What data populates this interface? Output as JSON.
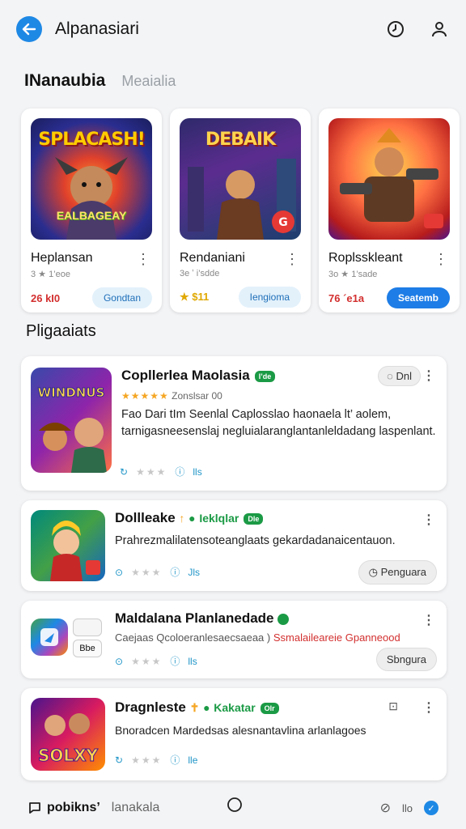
{
  "header": {
    "title": "Alpanasiari"
  },
  "tabs": {
    "active": "INanaubia",
    "inactive": "Meaialia"
  },
  "featured": [
    {
      "art_title": "SPLACASH!",
      "art_sub": "EALBAGEAY",
      "name": "Heplansan",
      "meta": "3 ★ 1’eoe",
      "price": "26 kI0",
      "button": "Gondtan"
    },
    {
      "art_title": "DEBAIK",
      "art_sub": "",
      "name": "Rendaniani",
      "meta": "3e ʼ i’sdde",
      "price": "★ $11",
      "button": "Iengioma"
    },
    {
      "art_title": "",
      "art_sub": "",
      "name": "Roplsskleant",
      "meta": "3o ★ 1’sade",
      "price": "76 ´e1a",
      "button": "Seatemb"
    }
  ],
  "section": {
    "title": "Pligaaiats"
  },
  "list": [
    {
      "name": "Copllerlea Maolasia",
      "badge": "I’de",
      "rating_text": "Zonslsar 00",
      "chip": "Dnl",
      "description": "Fao Dari tIm Seenlal Caplosslao haonaela lt’ aolem, tarnigasneesenslaj negluialaranglantanleldadang laspenlant.",
      "foot": "lls",
      "art_text": "WINDNUS"
    },
    {
      "name": "Dollleake",
      "badge": "Dle",
      "tag": "Ieklqlar",
      "description": "Prahrezmalilatensoteanglaats gekardadanaicentauon.",
      "foot": "Jls",
      "chip": "Penguara",
      "art_text": ""
    },
    {
      "name": "Maldalana Planlanedade",
      "badge": "",
      "description_a": "Caejaas Qcoloeranlesaecsaeaa )",
      "description_b": "Ssmalaileareie Gpanneood",
      "foot": "lls",
      "chip": "Sbngura",
      "art_text": ""
    },
    {
      "name": "Dragnleste",
      "badge": "Olr",
      "tag": "Kakatar",
      "description": "Bnoradcen Mardedsas alesnantavlina arlanlagoes",
      "foot": "lle",
      "art_text": "SOLXY"
    }
  ],
  "bottombar": {
    "left_bold": "pobikns’",
    "left_muted": "lanakala",
    "right_text": "llo"
  },
  "colors": {
    "accent": "#1e88e5",
    "green": "#1b9a45",
    "red": "#d32f2f"
  }
}
